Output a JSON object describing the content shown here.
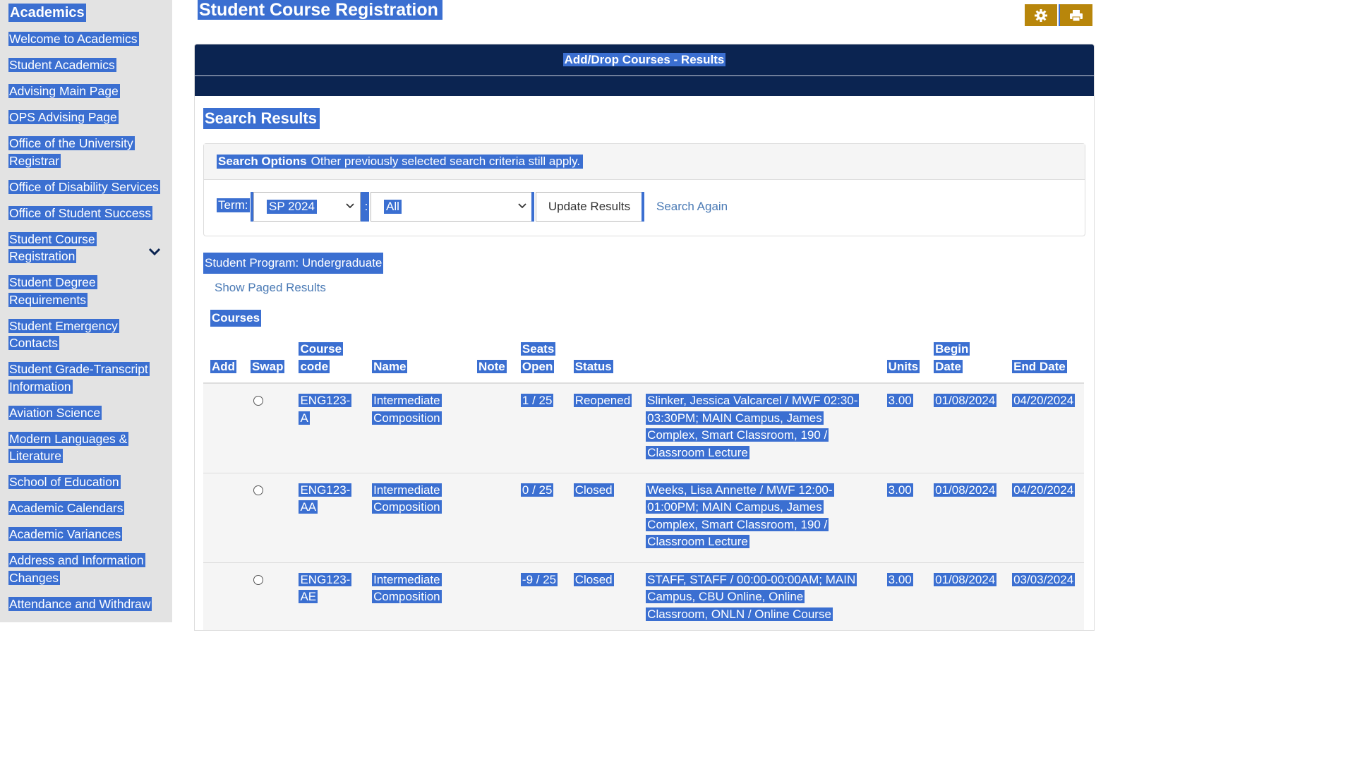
{
  "sidebar": {
    "title": "Academics",
    "items": [
      {
        "label": "Welcome to Academics"
      },
      {
        "label": "Student Academics"
      },
      {
        "label": "Advising Main Page"
      },
      {
        "label": "OPS Advising Page"
      },
      {
        "label": "Office of the University Registrar"
      },
      {
        "label": "Office of Disability Services"
      },
      {
        "label": "Office of Student Success"
      },
      {
        "label": "Student Course Registration"
      },
      {
        "label": "Student Degree Requirements"
      },
      {
        "label": "Student Emergency Contacts"
      },
      {
        "label": "Student Grade-Transcript Information"
      },
      {
        "label": "Aviation Science"
      },
      {
        "label": "Modern Languages & Literature"
      },
      {
        "label": "School of Education"
      },
      {
        "label": "Academic Calendars"
      },
      {
        "label": "Academic Variances"
      },
      {
        "label": "Address and Information Changes"
      },
      {
        "label": "Attendance and Withdraw"
      }
    ]
  },
  "header": {
    "title": "Student Course Registration",
    "settings_icon": "gear-icon",
    "print_icon": "print-icon",
    "accent_color": "#b8860b"
  },
  "panel": {
    "heading": "Add/Drop Courses - Results",
    "section_title": "Search Results",
    "search_options": {
      "title": "Search Options",
      "note": "Other previously selected search criteria still apply."
    },
    "term_label": "Term:",
    "term_value": "SP 2024",
    "separator": ":",
    "filter_value": "All",
    "update_button": "Update Results",
    "search_again": "Search Again",
    "program": "Student Program: Undergraduate",
    "paged_link": "Show Paged Results",
    "courses_label": "Courses"
  },
  "table": {
    "columns": [
      "Add",
      "Swap",
      "Course code",
      "Name",
      "Note",
      "Seats Open",
      "Status",
      "",
      "Units",
      "Begin Date",
      "End Date"
    ],
    "rows": [
      {
        "code": "ENG123-A",
        "name": "Intermediate Composition",
        "note": "",
        "seats": "1 / 25",
        "status": "Reopened",
        "details": "Slinker, Jessica Valcarcel / MWF 02:30-03:30PM; MAIN Campus, James Complex, Smart Classroom, 190 / Classroom Lecture",
        "units": "3.00",
        "begin": "01/08/2024",
        "end": "04/20/2024"
      },
      {
        "code": "ENG123-AA",
        "name": "Intermediate Composition",
        "note": "",
        "seats": "0 / 25",
        "status": "Closed",
        "details": "Weeks, Lisa Annette / MWF 12:00-01:00PM; MAIN Campus, James Complex, Smart Classroom, 190 / Classroom Lecture",
        "units": "3.00",
        "begin": "01/08/2024",
        "end": "04/20/2024"
      },
      {
        "code": "ENG123-AE",
        "name": "Intermediate Composition",
        "note": "",
        "seats": "-9 / 25",
        "status": "Closed",
        "details": "STAFF, STAFF / 00:00-00:00AM; MAIN Campus, CBU Online, Online Classroom, ONLN / Online Course",
        "units": "3.00",
        "begin": "01/08/2024",
        "end": "03/03/2024"
      }
    ]
  }
}
